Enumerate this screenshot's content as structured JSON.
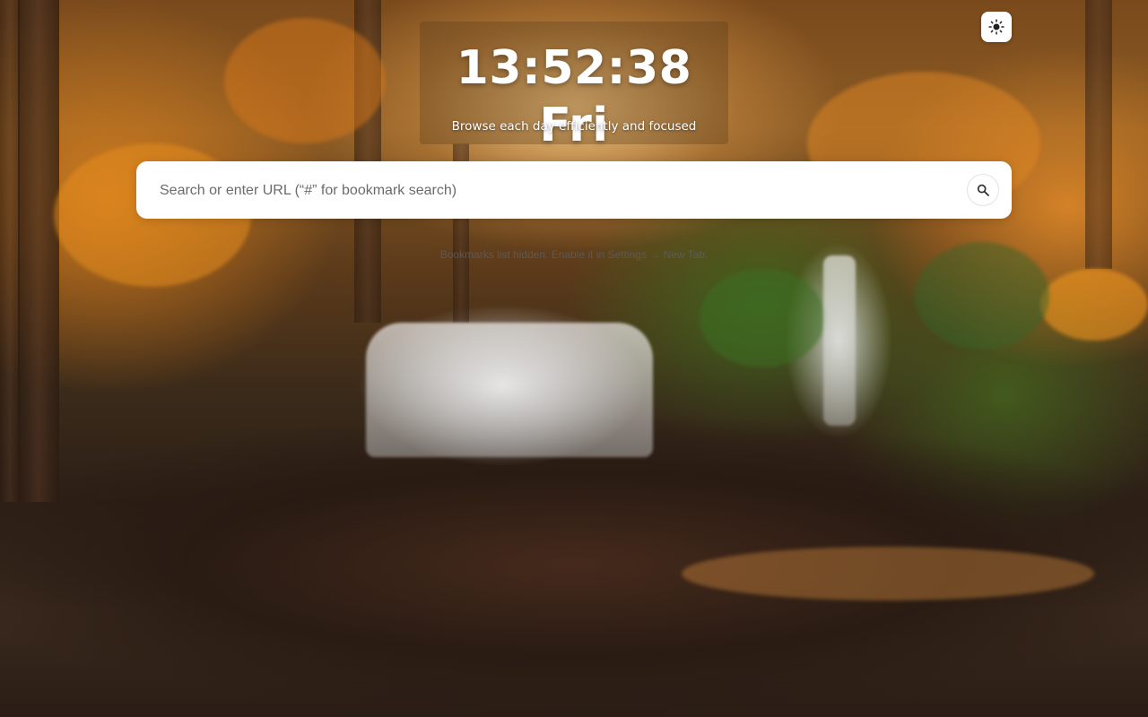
{
  "clock": {
    "time": "13:52:38 Fri",
    "subtitle": "Browse each day efficiently and focused"
  },
  "search": {
    "placeholder": "Search or enter URL (“#” for bookmark search)",
    "value": "",
    "button_icon": "search-icon"
  },
  "bookmarks": {
    "hint": "Bookmarks list hidden. Enable it in Settings → New Tab."
  },
  "theme_toggle": {
    "icon": "sun-icon"
  },
  "colors": {
    "panel_text": "#ffffff",
    "search_background": "#ffffff",
    "hint_text": "#5f5f5f"
  }
}
